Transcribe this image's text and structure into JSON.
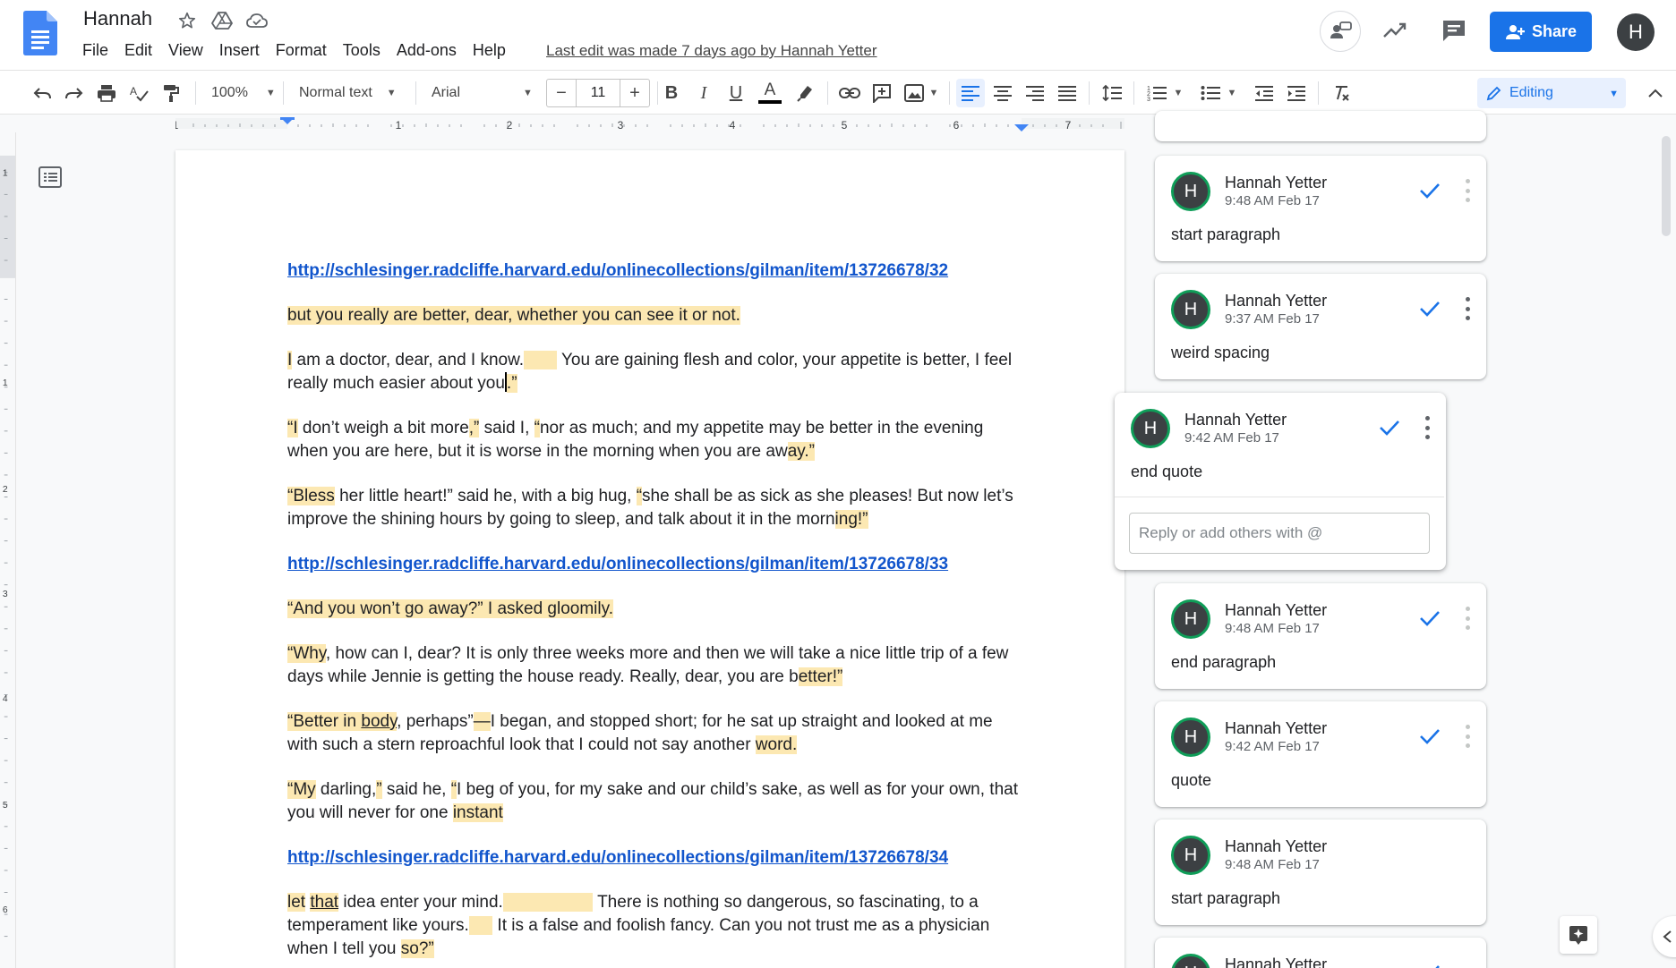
{
  "app": {
    "title": "Hannah",
    "last_edit": "Last edit was made 7 days ago by Hannah Yetter"
  },
  "menu": [
    "File",
    "Edit",
    "Insert",
    "Format",
    "Tools",
    "Add-ons",
    "Help",
    "View"
  ],
  "menu_ordered": [
    "File",
    "Edit",
    "View",
    "Insert",
    "Format",
    "Tools",
    "Add-ons",
    "Help"
  ],
  "header": {
    "share_label": "Share",
    "avatar_letter": "H"
  },
  "toolbar": {
    "zoom": "100%",
    "style": "Normal text",
    "font": "Arial",
    "font_size": "11",
    "mode": "Editing",
    "colors": {
      "accent": "#1a73e8",
      "highlight": "#fce8b2",
      "link": "#1155cc"
    }
  },
  "ruler": {
    "marks": [
      "1",
      "1",
      "2",
      "3",
      "4",
      "5",
      "6",
      "7"
    ]
  },
  "vruler": {
    "marks": [
      "1",
      "1",
      "2",
      "3",
      "4",
      "5",
      "6"
    ]
  },
  "document": {
    "link1": "http://schlesinger.radcliffe.harvard.edu/onlinecollections/gilman/item/13726678/32",
    "p1": "but you really are better, dear, whether you can see it or not.",
    "p2a": "I",
    "p2b": " am a doctor, dear, and I know.",
    "p2c": "       ",
    "p2d": " You are gaining flesh and color, your appetite is better, I feel really much easier about you",
    "p2e": ".”",
    "p3a": "“I",
    "p3b": " don’t weigh a bit more",
    "p3c": ",”",
    "p3d": " said I, ",
    "p3e": "“",
    "p3f": "nor as much; and my appetite may be better in the evening when you are here, but it is worse in the morning when you are aw",
    "p3g": "ay.”",
    "p4a": "“Bless",
    "p4b": " her little heart!” said he, with a big hug, ",
    "p4c": "“",
    "p4d": "she shall be as sick as she pleases! But now let’s improve the shining hours by going to sleep, and talk about it in the morn",
    "p4e": "ing!”",
    "link2": "http://schlesinger.radcliffe.harvard.edu/onlinecollections/gilman/item/13726678/33",
    "p5": "“And you won’t go away?” I asked gloomily.",
    "p6a": "“Why",
    "p6b": ", how can I, dear? It is only three weeks more and then we will take a nice little trip of a few days while Jennie is getting the house ready. Really, dear, you are b",
    "p6c": "etter!”",
    "p7a": "“Better in ",
    "p7b": "body",
    "p7c": ", perhaps”",
    "p7d": "—",
    "p7e": "I began, and stopped short; for he sat up straight and looked at me with such a stern reproachful look that I could not say another ",
    "p7f": "word.",
    "p8a": "“My",
    "p8b": " darling,",
    "p8c": "”",
    "p8d": " said he, ",
    "p8e": "“",
    "p8f": "I beg of you, for my sake and our child’s sake, as well as for your own, that you will never for one ",
    "p8g": "instant",
    "link3": "http://schlesinger.radcliffe.harvard.edu/onlinecollections/gilman/item/13726678/34",
    "p9a": "let",
    "p9b": " ",
    "p9c": "that",
    "p9d": " idea enter your mind.",
    "p9e": "                   ",
    "p9f": " There is nothing so dangerous, so fascinating, to a temperament like yours.",
    "p9g": "     ",
    "p9h": "  It is a false and foolish fancy. Can you not trust me as a physician when I tell you ",
    "p9i": "so?”"
  },
  "comments": [
    {
      "name": "Hannah Yetter",
      "time": "9:48 AM Feb 17",
      "text": "start paragraph"
    },
    {
      "name": "Hannah Yetter",
      "time": "9:37 AM Feb 17",
      "text": "weird spacing"
    },
    {
      "name": "Hannah Yetter",
      "time": "9:42 AM Feb 17",
      "text": "end quote",
      "reply_placeholder": "Reply or add others with @"
    },
    {
      "name": "Hannah Yetter",
      "time": "9:48 AM Feb 17",
      "text": "end paragraph"
    },
    {
      "name": "Hannah Yetter",
      "time": "9:42 AM Feb 17",
      "text": "quote"
    },
    {
      "name": "Hannah Yetter",
      "time": "9:48 AM Feb 17",
      "text": "start paragraph"
    },
    {
      "name": "Hannah Yetter"
    }
  ],
  "avatar_letter": "H"
}
